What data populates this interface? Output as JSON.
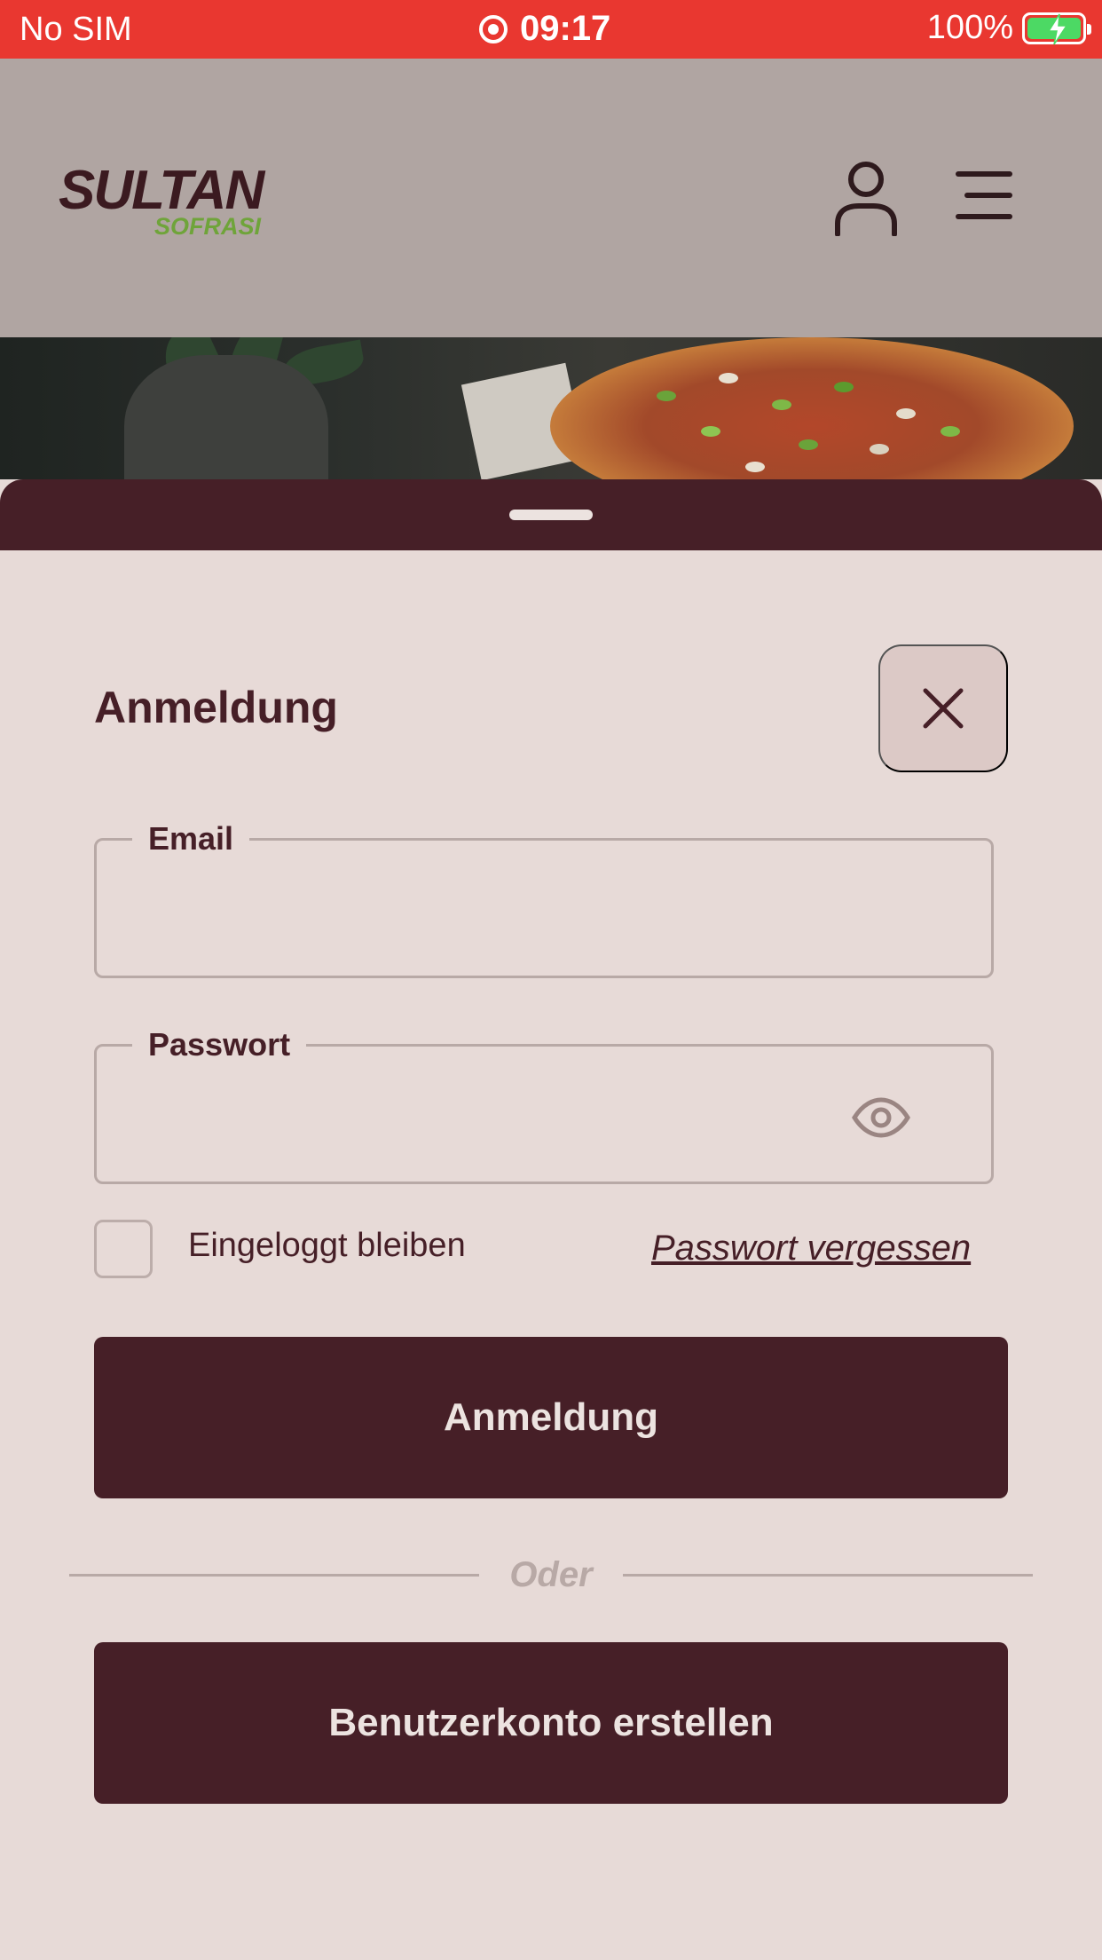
{
  "status_bar": {
    "carrier": "No SIM",
    "time": "09:17",
    "battery": "100%"
  },
  "header": {
    "logo_main": "SULTAN",
    "logo_sub": "SOFRASI",
    "user_icon": "user-icon",
    "menu_icon": "hamburger-menu-icon"
  },
  "login": {
    "title": "Anmeldung",
    "close_icon": "close-icon",
    "email_label": "Email",
    "email_value": "",
    "password_label": "Passwort",
    "password_value": "",
    "password_toggle_icon": "eye-icon",
    "remember_label": "Eingeloggt bleiben",
    "remember_checked": false,
    "forgot_label": "Passwort vergessen",
    "login_button": "Anmeldung",
    "divider_text": "Oder",
    "register_button": "Benutzerkonto erstellen"
  },
  "colors": {
    "status_bar": "#e93730",
    "header_bg": "#b0a5a2",
    "primary": "#461f27",
    "sheet_bg": "#e7dad7",
    "logo_accent": "#6fa43a"
  }
}
